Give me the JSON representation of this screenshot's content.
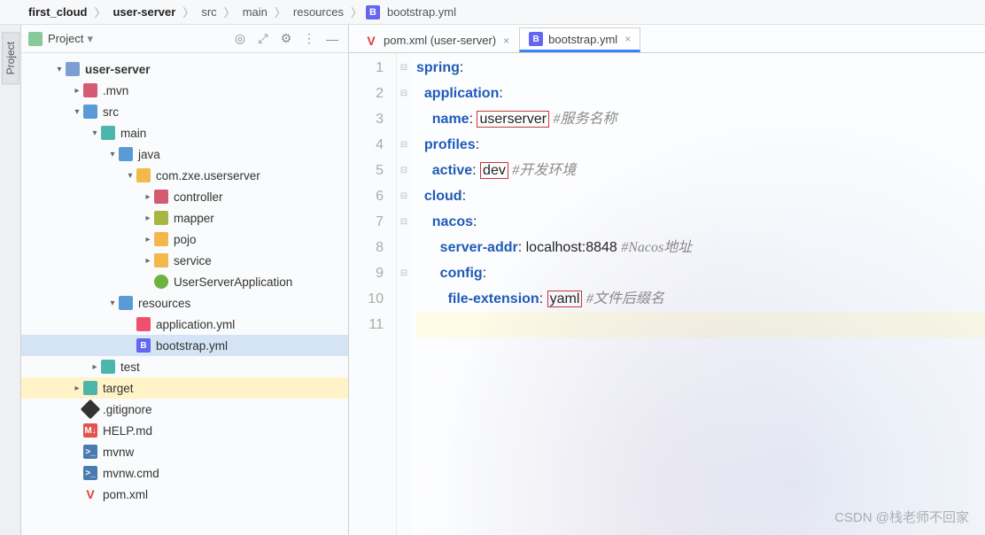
{
  "breadcrumb": {
    "items": [
      "first_cloud",
      "user-server",
      "src",
      "main",
      "resources"
    ],
    "file": "bootstrap.yml",
    "file_icon_letter": "B"
  },
  "sidebar": {
    "label": "Project"
  },
  "panel": {
    "title": "Project",
    "tools": {
      "target": "◎",
      "expand": "⤢",
      "gear": "⚙",
      "more": "⋮",
      "minimize": "—"
    }
  },
  "tree": [
    {
      "depth": 0,
      "chev": "v",
      "icon": "mod",
      "label": "user-server",
      "bold": true
    },
    {
      "depth": 1,
      "chev": ">",
      "icon": "fold-red",
      "label": ".mvn"
    },
    {
      "depth": 1,
      "chev": "v",
      "icon": "fold-blue",
      "label": "src"
    },
    {
      "depth": 2,
      "chev": "v",
      "icon": "fold-teal",
      "label": "main"
    },
    {
      "depth": 3,
      "chev": "v",
      "icon": "fold-blue",
      "label": "java"
    },
    {
      "depth": 4,
      "chev": "v",
      "icon": "fold-yellow",
      "label": "com.zxe.userserver"
    },
    {
      "depth": 5,
      "chev": ">",
      "icon": "fold-red",
      "label": "controller"
    },
    {
      "depth": 5,
      "chev": ">",
      "icon": "fold-olive",
      "label": "mapper"
    },
    {
      "depth": 5,
      "chev": ">",
      "icon": "fold-yellow",
      "label": "pojo"
    },
    {
      "depth": 5,
      "chev": ">",
      "icon": "fold-yellow",
      "label": "service"
    },
    {
      "depth": 5,
      "chev": "",
      "icon": "file-spring",
      "label": "UserServerApplication"
    },
    {
      "depth": 3,
      "chev": "v",
      "icon": "fold-blue",
      "label": "resources"
    },
    {
      "depth": 4,
      "chev": "",
      "icon": "file-yml",
      "label": "application.yml"
    },
    {
      "depth": 4,
      "chev": "",
      "icon": "file-b",
      "label": "bootstrap.yml",
      "selected": true,
      "icon_letter": "B"
    },
    {
      "depth": 2,
      "chev": ">",
      "icon": "fold-teal",
      "label": "test"
    },
    {
      "depth": 1,
      "chev": ">",
      "icon": "fold-teal",
      "label": "target",
      "highlighted": true
    },
    {
      "depth": 1,
      "chev": "",
      "icon": "file-git",
      "label": ".gitignore"
    },
    {
      "depth": 1,
      "chev": "",
      "icon": "file-md",
      "label": "HELP.md",
      "icon_letter": "M↓"
    },
    {
      "depth": 1,
      "chev": "",
      "icon": "file-sh",
      "label": "mvnw",
      "icon_letter": ">_"
    },
    {
      "depth": 1,
      "chev": "",
      "icon": "file-sh",
      "label": "mvnw.cmd",
      "icon_letter": ">_"
    },
    {
      "depth": 1,
      "chev": "",
      "icon": "file-v",
      "label": "pom.xml",
      "icon_letter": "V"
    }
  ],
  "tabs": [
    {
      "icon": "file-v",
      "icon_letter": "V",
      "label": "pom.xml (user-server)",
      "active": false
    },
    {
      "icon": "file-b",
      "icon_letter": "B",
      "label": "bootstrap.yml",
      "active": true
    }
  ],
  "code": {
    "lines": [
      {
        "n": 1,
        "segs": [
          {
            "t": "spring",
            "cls": "k"
          },
          {
            "t": ":",
            "cls": "v"
          }
        ]
      },
      {
        "n": 2,
        "segs": [
          {
            "t": "  ",
            "cls": ""
          },
          {
            "t": "application",
            "cls": "k"
          },
          {
            "t": ":",
            "cls": "v"
          }
        ]
      },
      {
        "n": 3,
        "segs": [
          {
            "t": "    ",
            "cls": ""
          },
          {
            "t": "name",
            "cls": "k"
          },
          {
            "t": ": ",
            "cls": "v"
          },
          {
            "t": "userserver",
            "cls": "v boxed"
          },
          {
            "t": " ",
            "cls": ""
          },
          {
            "t": "#服务名称",
            "cls": "c"
          }
        ]
      },
      {
        "n": 4,
        "segs": [
          {
            "t": "  ",
            "cls": ""
          },
          {
            "t": "profiles",
            "cls": "k"
          },
          {
            "t": ":",
            "cls": "v"
          }
        ]
      },
      {
        "n": 5,
        "segs": [
          {
            "t": "    ",
            "cls": ""
          },
          {
            "t": "active",
            "cls": "k"
          },
          {
            "t": ": ",
            "cls": "v"
          },
          {
            "t": "dev",
            "cls": "v boxed"
          },
          {
            "t": " ",
            "cls": ""
          },
          {
            "t": "#开发环境",
            "cls": "c"
          }
        ]
      },
      {
        "n": 6,
        "segs": [
          {
            "t": "  ",
            "cls": ""
          },
          {
            "t": "cloud",
            "cls": "k"
          },
          {
            "t": ":",
            "cls": "v"
          }
        ]
      },
      {
        "n": 7,
        "segs": [
          {
            "t": "    ",
            "cls": ""
          },
          {
            "t": "nacos",
            "cls": "k"
          },
          {
            "t": ":",
            "cls": "v"
          }
        ]
      },
      {
        "n": 8,
        "segs": [
          {
            "t": "      ",
            "cls": ""
          },
          {
            "t": "server-addr",
            "cls": "k"
          },
          {
            "t": ": ",
            "cls": "v"
          },
          {
            "t": "localhost:8848",
            "cls": "v"
          },
          {
            "t": " ",
            "cls": ""
          },
          {
            "t": "#Nacos地址",
            "cls": "c"
          }
        ]
      },
      {
        "n": 9,
        "segs": [
          {
            "t": "      ",
            "cls": ""
          },
          {
            "t": "config",
            "cls": "k"
          },
          {
            "t": ":",
            "cls": "v"
          }
        ]
      },
      {
        "n": 10,
        "segs": [
          {
            "t": "        ",
            "cls": ""
          },
          {
            "t": "file-extension",
            "cls": "k"
          },
          {
            "t": ": ",
            "cls": "v"
          },
          {
            "t": "yaml",
            "cls": "v boxed"
          },
          {
            "t": " ",
            "cls": ""
          },
          {
            "t": "#文件后缀名",
            "cls": "c"
          }
        ]
      },
      {
        "n": 11,
        "current": true,
        "segs": []
      }
    ],
    "fold_markers": [
      "⊟",
      "⊟",
      "",
      "⊟",
      "⊟",
      "⊟",
      "⊟",
      "",
      "⊟",
      "",
      ""
    ]
  },
  "watermark": "CSDN @栈老师不回家"
}
